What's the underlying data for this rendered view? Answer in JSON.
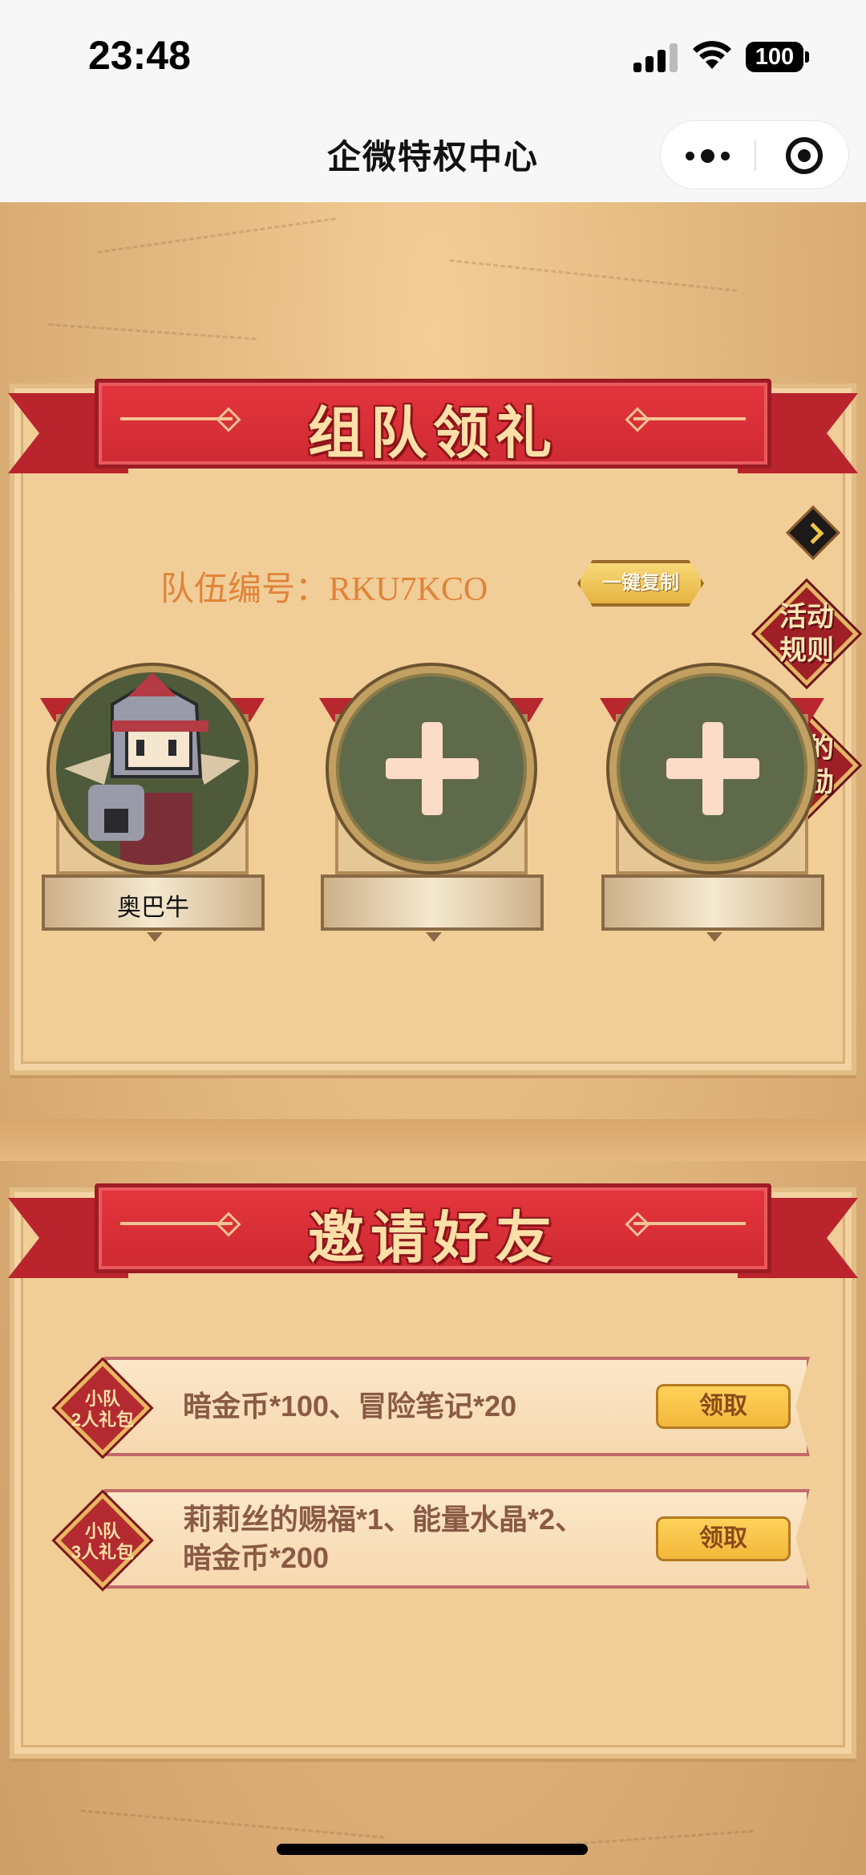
{
  "status_bar": {
    "time": "23:48",
    "battery": "100"
  },
  "nav": {
    "title": "企微特权中心"
  },
  "team_section": {
    "title": "组队领礼",
    "team_number_label": "队伍编号：",
    "team_number": "RKU7KCO",
    "copy_button": "一键复制",
    "side_buttons": {
      "rules": [
        "活动",
        "规则"
      ],
      "rewards": [
        "我的",
        "奖励"
      ]
    },
    "members": [
      {
        "name": "奥巴牛",
        "filled": true
      },
      {
        "name": "",
        "filled": false
      },
      {
        "name": "",
        "filled": false
      }
    ]
  },
  "invite_section": {
    "title": "邀请好友",
    "gifts": [
      {
        "badge_line1": "小队",
        "badge_line2": "2人礼包",
        "desc_line1": "暗金币*100、冒险笔记*20",
        "desc_line2": "",
        "button": "领取"
      },
      {
        "badge_line1": "小队",
        "badge_line2": "3人礼包",
        "desc_line1": "莉莉丝的赐福*1、能量水晶*2、",
        "desc_line2": "暗金币*200",
        "button": "领取"
      }
    ]
  }
}
